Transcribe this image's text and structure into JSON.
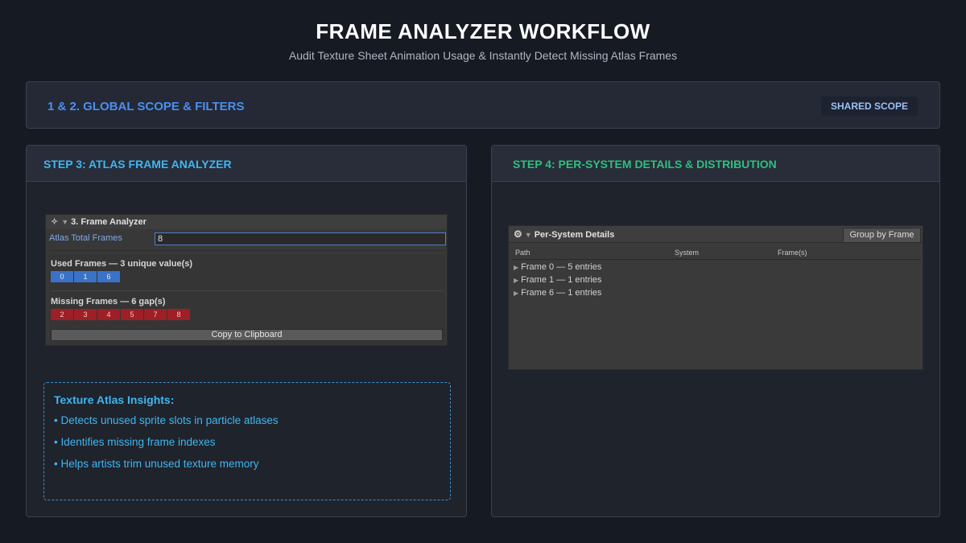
{
  "header": {
    "title": "FRAME ANALYZER WORKFLOW",
    "subtitle": "Audit Texture Sheet Animation Usage & Instantly Detect Missing Atlas Frames"
  },
  "scope": {
    "title": "1 & 2. GLOBAL SCOPE & FILTERS",
    "badge": "SHARED SCOPE"
  },
  "step3": {
    "title": "STEP 3: ATLAS FRAME ANALYZER",
    "inspector": {
      "icon": "crosshair-icon",
      "title": "3. Frame Analyzer",
      "field_label": "Atlas Total Frames",
      "field_value": "8",
      "used_title": "Used Frames — 3 unique value(s)",
      "used_frames": [
        "0",
        "1",
        "6"
      ],
      "missing_title": "Missing Frames — 6 gap(s)",
      "missing_frames": [
        "2",
        "3",
        "4",
        "5",
        "7",
        "8"
      ],
      "copy_label": "Copy to Clipboard"
    },
    "insights": {
      "title": "Texture Atlas Insights:",
      "items": [
        "• Detects unused sprite slots in particle atlases",
        "• Identifies missing frame indexes",
        "• Helps artists trim unused texture memory"
      ]
    }
  },
  "step4": {
    "title": "STEP 4: PER-SYSTEM DETAILS & DISTRIBUTION",
    "inspector": {
      "icon": "gear-icon",
      "title": "Per-System Details",
      "group_button": "Group by Frame",
      "columns": [
        "Path",
        "System",
        "Frame(s)"
      ],
      "rows": [
        "Frame 0 — 5 entries",
        "Frame 1 — 1 entries",
        "Frame 6 — 1 entries"
      ]
    }
  },
  "colors": {
    "background": "#161a22",
    "step3_accent": "#3fb6f0",
    "step4_accent": "#2fbf7f",
    "scope_accent": "#4c8ef0",
    "used_chip": "#3a72c8",
    "missing_chip": "#9e1f25"
  }
}
